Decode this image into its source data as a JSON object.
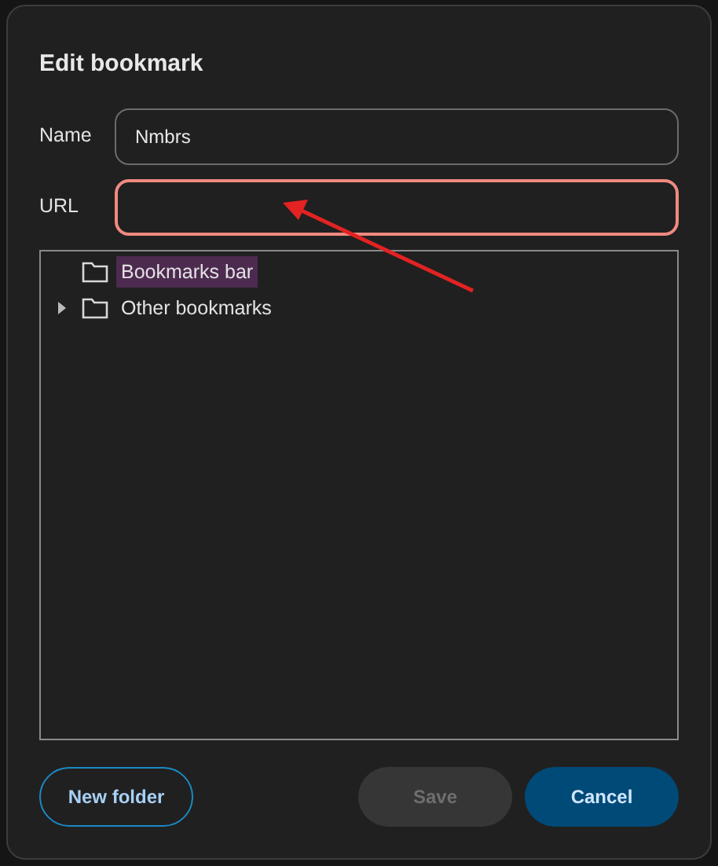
{
  "dialog": {
    "title": "Edit bookmark"
  },
  "fields": [
    {
      "label": "Name",
      "value": "Nmbrs",
      "invalid": false
    },
    {
      "label": "URL",
      "invalid": true
    }
  ],
  "folder_tree": [
    {
      "label": "Bookmarks bar",
      "has_children": false,
      "selected": true
    },
    {
      "label": "Other bookmarks",
      "has_children": true,
      "expanded": false,
      "selected": false
    }
  ],
  "buttons": [
    {
      "label": "New folder",
      "kind": "outline",
      "disabled": false
    },
    {
      "label": "Save",
      "kind": "secondary",
      "disabled": true
    },
    {
      "label": "Cancel",
      "kind": "primary",
      "disabled": false
    }
  ]
}
